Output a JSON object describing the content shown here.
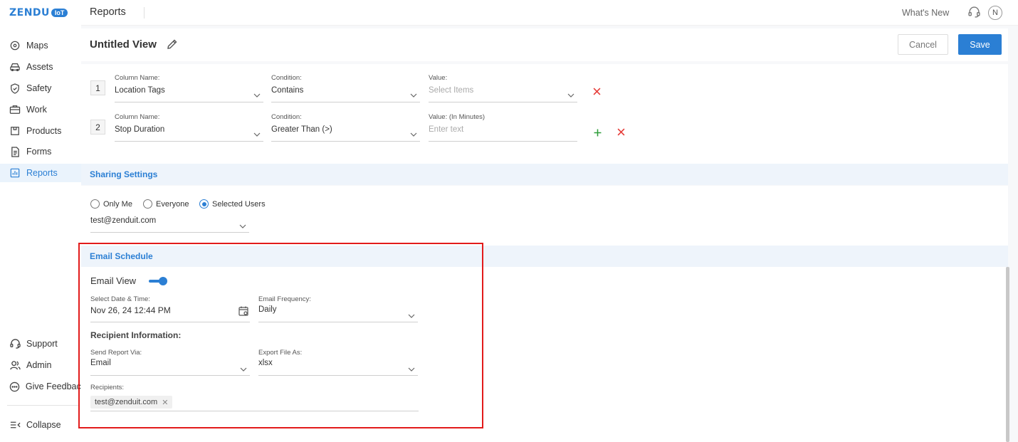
{
  "brand": {
    "logo_text": "ZENDU",
    "logo_badge": "IoT"
  },
  "topbar": {
    "title": "Reports",
    "whats_new": "What's New",
    "avatar_initial": "N"
  },
  "sidebar": {
    "items": [
      {
        "label": "Maps",
        "icon": "map-pin-icon"
      },
      {
        "label": "Assets",
        "icon": "car-icon"
      },
      {
        "label": "Safety",
        "icon": "shield-icon"
      },
      {
        "label": "Work",
        "icon": "briefcase-icon"
      },
      {
        "label": "Products",
        "icon": "box-icon"
      },
      {
        "label": "Forms",
        "icon": "document-icon"
      },
      {
        "label": "Reports",
        "icon": "chart-icon",
        "active": true
      }
    ],
    "bottom_items": [
      {
        "label": "Support",
        "icon": "headset-icon"
      },
      {
        "label": "Admin",
        "icon": "users-icon"
      },
      {
        "label": "Give Feedback",
        "icon": "chat-icon"
      }
    ],
    "collapse_label": "Collapse"
  },
  "view": {
    "title": "Untitled View",
    "cancel_label": "Cancel",
    "save_label": "Save"
  },
  "filters": [
    {
      "num": "1",
      "column_label": "Column Name:",
      "column_value": "Location Tags",
      "condition_label": "Condition:",
      "condition_value": "Contains",
      "value_label": "Value:",
      "value_placeholder": "Select Items"
    },
    {
      "num": "2",
      "column_label": "Column Name:",
      "column_value": "Stop Duration",
      "condition_label": "Condition:",
      "condition_value": "Greater Than (>)",
      "value_label": "Value: (In Minutes)",
      "value_placeholder": "Enter text"
    }
  ],
  "sharing": {
    "heading": "Sharing Settings",
    "options": [
      "Only Me",
      "Everyone",
      "Selected Users"
    ],
    "selected": "Selected Users",
    "user_select_value": "test@zenduit.com"
  },
  "email_schedule": {
    "heading": "Email Schedule",
    "email_view_label": "Email View",
    "email_view_enabled": true,
    "date_label": "Select Date & Time:",
    "date_value": "Nov 26, 24 12:44 PM",
    "frequency_label": "Email Frequency:",
    "frequency_value": "Daily",
    "recipient_heading": "Recipient Information:",
    "send_via_label": "Send Report Via:",
    "send_via_value": "Email",
    "export_label": "Export File As:",
    "export_value": "xlsx",
    "recipients_label": "Recipients:",
    "recipients": [
      "test@zenduit.com"
    ]
  },
  "colors": {
    "accent": "#2b7fd4",
    "danger": "#e53935",
    "add": "#2e9e3a",
    "highlight_box": "#e21b1b"
  }
}
